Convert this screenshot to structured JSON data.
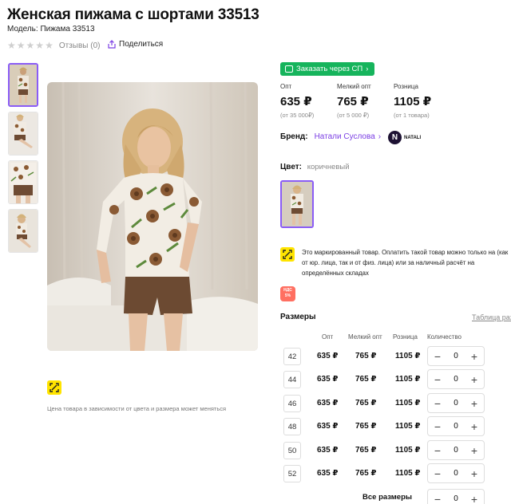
{
  "product": {
    "title": "Женская пижама с шортами 33513",
    "model_label": "Модель:",
    "model_value": "Пижама 33513",
    "reviews": "Отзывы (0)",
    "share": "Поделиться"
  },
  "buy": {
    "label": "Заказать через СП",
    "chevron": "›"
  },
  "prices": [
    {
      "label": "Опт",
      "value": "635 ₽",
      "sub": "(от 35 000₽)"
    },
    {
      "label": "Мелкий опт",
      "value": "765 ₽",
      "sub": "(от 5 000 ₽)"
    },
    {
      "label": "Розница",
      "value": "1105 ₽",
      "sub": "(от 1 товара)"
    }
  ],
  "brand": {
    "label": "Бренд:",
    "name": "Натали Суслова",
    "chevron": "›",
    "logo_letter": "N",
    "logo_text": "NATALI"
  },
  "color": {
    "label": "Цвет:",
    "value": "коричневый"
  },
  "marked_text": "Это маркированный товар. Оплатить такой товар можно только на (как от юр. лица, так и от физ. лица) или за наличный расчёт на определённых складах",
  "vat": {
    "line1": "НДС",
    "line2": "5%"
  },
  "price_note": "Цена товара в зависимости от цвета и размера может меняться",
  "sizes": {
    "title": "Размеры",
    "table_link": "Таблица разм",
    "headers": {
      "opt": "Опт",
      "small_opt": "Мелкий опт",
      "retail": "Розница",
      "qty": "Количество"
    },
    "rows": [
      {
        "size": "42",
        "opt": "635 ₽",
        "small_opt": "765 ₽",
        "retail": "1105 ₽",
        "qty": "0"
      },
      {
        "size": "44",
        "opt": "635 ₽",
        "small_opt": "765 ₽",
        "retail": "1105 ₽",
        "qty": "0"
      },
      {
        "size": "46",
        "opt": "635 ₽",
        "small_opt": "765 ₽",
        "retail": "1105 ₽",
        "qty": "0"
      },
      {
        "size": "48",
        "opt": "635 ₽",
        "small_opt": "765 ₽",
        "retail": "1105 ₽",
        "qty": "0"
      },
      {
        "size": "50",
        "opt": "635 ₽",
        "small_opt": "765 ₽",
        "retail": "1105 ₽",
        "qty": "0"
      },
      {
        "size": "52",
        "opt": "635 ₽",
        "small_opt": "765 ₽",
        "retail": "1105 ₽",
        "qty": "0"
      }
    ],
    "all_label": "Все размеры",
    "all_qty": "0",
    "minus": "−",
    "plus": "+"
  },
  "colors": {
    "accent": "#8a5cf6",
    "buy_green": "#16b45c",
    "brand_link": "#7b3fe4",
    "mark_yellow": "#ffe400"
  },
  "icons": [
    "star-icon",
    "share-icon",
    "cart-icon",
    "datamatrix-mark-icon",
    "vat-badge-icon",
    "minus-icon",
    "plus-icon"
  ]
}
